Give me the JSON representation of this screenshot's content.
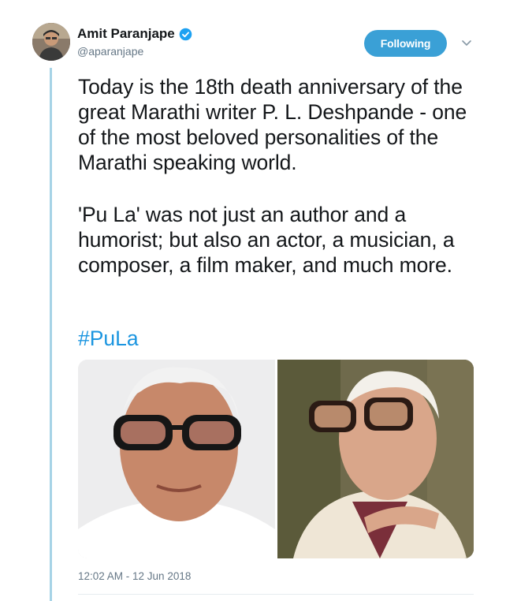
{
  "tweet": {
    "author_name": "Amit Paranjape",
    "author_handle": "@aparanjape",
    "follow_label": "Following",
    "paragraph_1": "Today is the 18th death anniversary of the great Marathi writer P. L. Deshpande - one of the most beloved personalities of the Marathi speaking world.",
    "paragraph_2": "'Pu La' was not just an author and a humorist; but also an actor, a musician, a composer, a film maker, and much more.",
    "hashtag": "#PuLa",
    "timestamp": "12:02 AM - 12 Jun 2018"
  },
  "icons": {
    "verified": "verified-badge-icon",
    "menu": "chevron-down-icon"
  },
  "colors": {
    "follow_button": "#3aa0d6",
    "hashtag": "#1b95e0",
    "thread_line": "#a6d3e6",
    "verified": "#1da1f2"
  }
}
